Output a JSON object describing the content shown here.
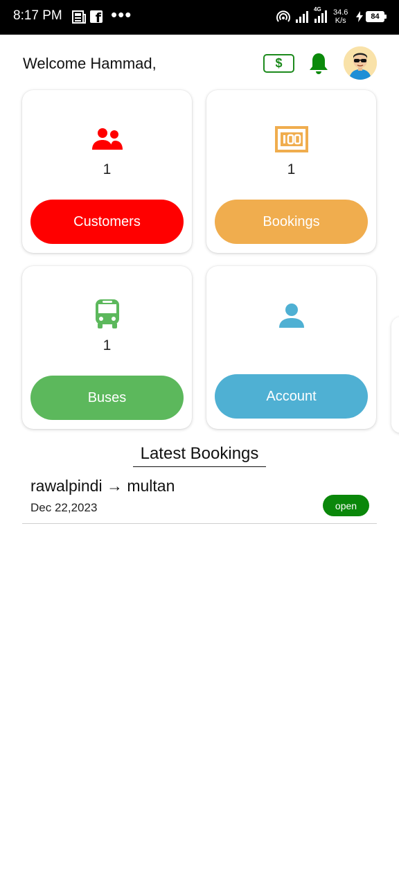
{
  "status_bar": {
    "time": "8:17 PM",
    "dots": "•••",
    "network": "4G",
    "speed_value": "34.6",
    "speed_unit": "K/s",
    "battery": "84",
    "icons": [
      "news-icon",
      "facebook-icon",
      "hotspot-icon",
      "signal-icon",
      "signal-icon",
      "charging-icon",
      "battery-icon"
    ]
  },
  "header": {
    "welcome": "Welcome Hammad,",
    "wallet_symbol": "$",
    "icons": [
      "wallet-icon",
      "bell-icon",
      "avatar"
    ]
  },
  "cards": [
    {
      "icon": "customers-icon",
      "count": "1",
      "button": "Customers",
      "color": "#ff0000"
    },
    {
      "icon": "bookings-icon",
      "count": "1",
      "button": "Bookings",
      "color": "#f0ad4e"
    },
    {
      "icon": "bus-icon",
      "count": "1",
      "button": "Buses",
      "color": "#5cb85c"
    },
    {
      "icon": "account-icon",
      "count": "",
      "button": "Account",
      "color": "#4fb0d3"
    }
  ],
  "latest_bookings": {
    "title": "Latest Bookings",
    "items": [
      {
        "route": "rawalpindi → multan",
        "date": "Dec 22,2023",
        "status": "open"
      }
    ]
  },
  "colors": {
    "customers": "#ff0000",
    "bookings": "#f0ad4e",
    "buses": "#5cb85c",
    "account": "#4fb0d3",
    "bell": "#0b8a0b",
    "status_open": "#0a870a"
  }
}
